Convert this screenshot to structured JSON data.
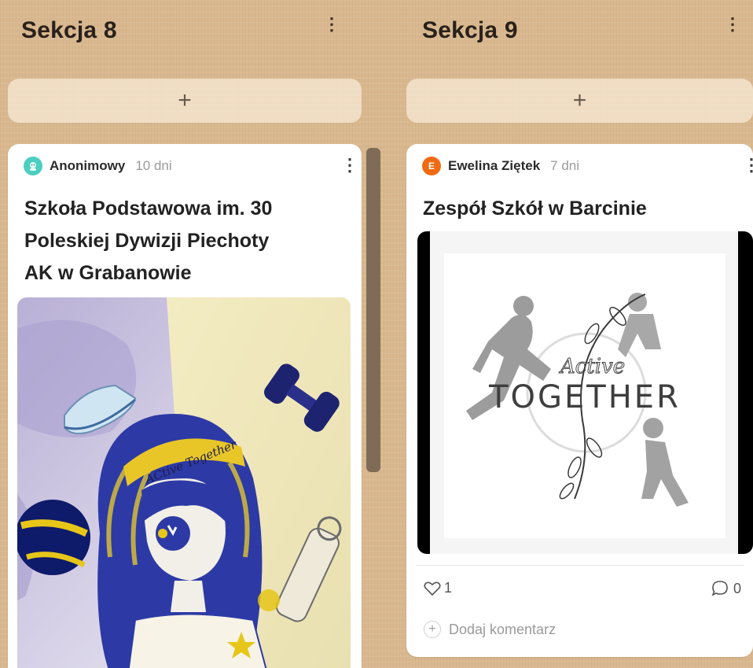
{
  "sections": [
    {
      "title": "Sekcja 8",
      "add_label": "+",
      "post": {
        "author": "Anonimowy",
        "time": "10 dni",
        "avatar_color": "#4ccfc0",
        "title_lines": [
          "Szkoła Podstawowa im. 30",
          "Poleskiej Dywizji Piechoty",
          "AK w Grabanowie"
        ],
        "image_text": "ACtive Together"
      }
    },
    {
      "title": "Sekcja 9",
      "add_label": "+",
      "post": {
        "author": "Ewelina Ziętek",
        "time": "7 dni",
        "avatar_letter": "E",
        "avatar_color": "#f06a12",
        "title": "Zespół Szkół w Barcinie",
        "image_script": "Active",
        "image_word": "TOGETHER",
        "likes": "1",
        "comments": "0",
        "add_comment": "Dodaj komentarz"
      }
    }
  ],
  "icons": {
    "menu": "more-vertical-icon",
    "like": "heart-icon",
    "comment": "speech-bubble-icon",
    "add": "plus-icon"
  }
}
